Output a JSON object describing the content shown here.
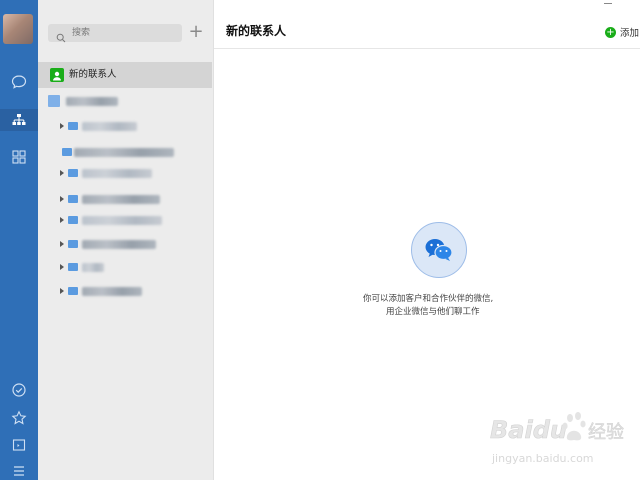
{
  "search": {
    "placeholder": "搜索"
  },
  "header": {
    "title": "新的联系人",
    "add_label": "添加"
  },
  "sidebar": {
    "new_contact_label": "新的联系人"
  },
  "empty_state": {
    "line1": "你可以添加客户和合作伙伴的微信,",
    "line2": "用企业微信与他们聊工作"
  },
  "nav": {
    "icons": [
      "chat-icon",
      "org-chart-icon",
      "apps-grid-icon",
      "check-circle-icon",
      "star-icon",
      "box-icon",
      "menu-icon"
    ]
  },
  "colors": {
    "nav_bg": "#2f6fb7",
    "accent_green": "#1aad19",
    "selection_bg": "#d4d4d4",
    "folder_blue": "#5b9be0"
  },
  "watermark": {
    "brand": "Baidu",
    "suffix": "经验",
    "url": "jingyan.baidu.com"
  }
}
